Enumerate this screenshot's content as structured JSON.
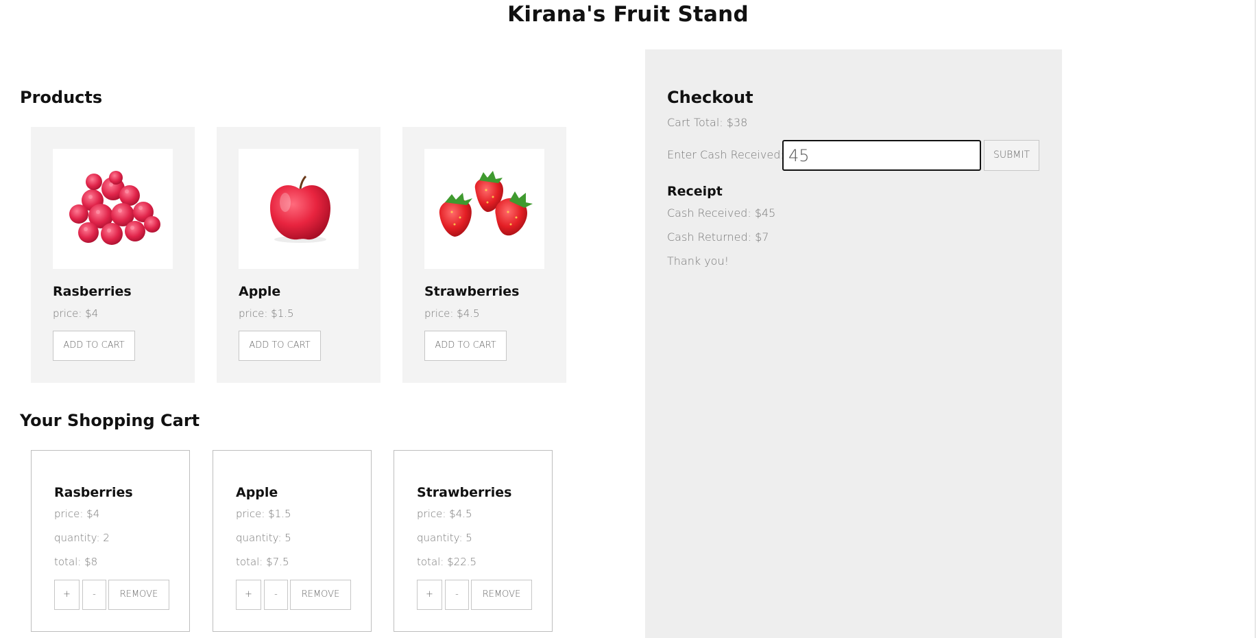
{
  "app": {
    "title": "Kirana's Fruit Stand"
  },
  "products": {
    "title": "Products",
    "items": [
      {
        "name": "Rasberries",
        "price": "price: $4",
        "button": "ADD TO CART",
        "image": "raspberries-image"
      },
      {
        "name": "Apple",
        "price": "price: $1.5",
        "button": "ADD TO CART",
        "image": "apple-image"
      },
      {
        "name": "Strawberries",
        "price": "price: $4.5",
        "button": "ADD TO CART",
        "image": "strawberries-image"
      }
    ]
  },
  "cart": {
    "title": "Your Shopping Cart",
    "items": [
      {
        "name": "Rasberries",
        "price": "price: $4",
        "quantity": "quantity: 2",
        "total": "total: $8",
        "plus": "+",
        "minus": "-",
        "remove": "REMOVE"
      },
      {
        "name": "Apple",
        "price": "price: $1.5",
        "quantity": "quantity: 5",
        "total": "total: $7.5",
        "plus": "+",
        "minus": "-",
        "remove": "REMOVE"
      },
      {
        "name": "Strawberries",
        "price": "price: $4.5",
        "quantity": "quantity: 5",
        "total": "total: $22.5",
        "plus": "+",
        "minus": "-",
        "remove": "REMOVE"
      }
    ]
  },
  "checkout": {
    "title": "Checkout",
    "cart_total": "Cart Total: $38",
    "cash_label": "Enter Cash Received:",
    "cash_value": "45",
    "submit_label": "SUBMIT",
    "receipt": {
      "title": "Receipt",
      "cash_received": "Cash Received: $45",
      "cash_returned": "Cash Returned: $7",
      "message": "Thank you!"
    }
  },
  "colors": {
    "card_bg": "#f3f3f3",
    "panel_bg": "#eeeeee",
    "fruit_red": "#e8243f"
  }
}
